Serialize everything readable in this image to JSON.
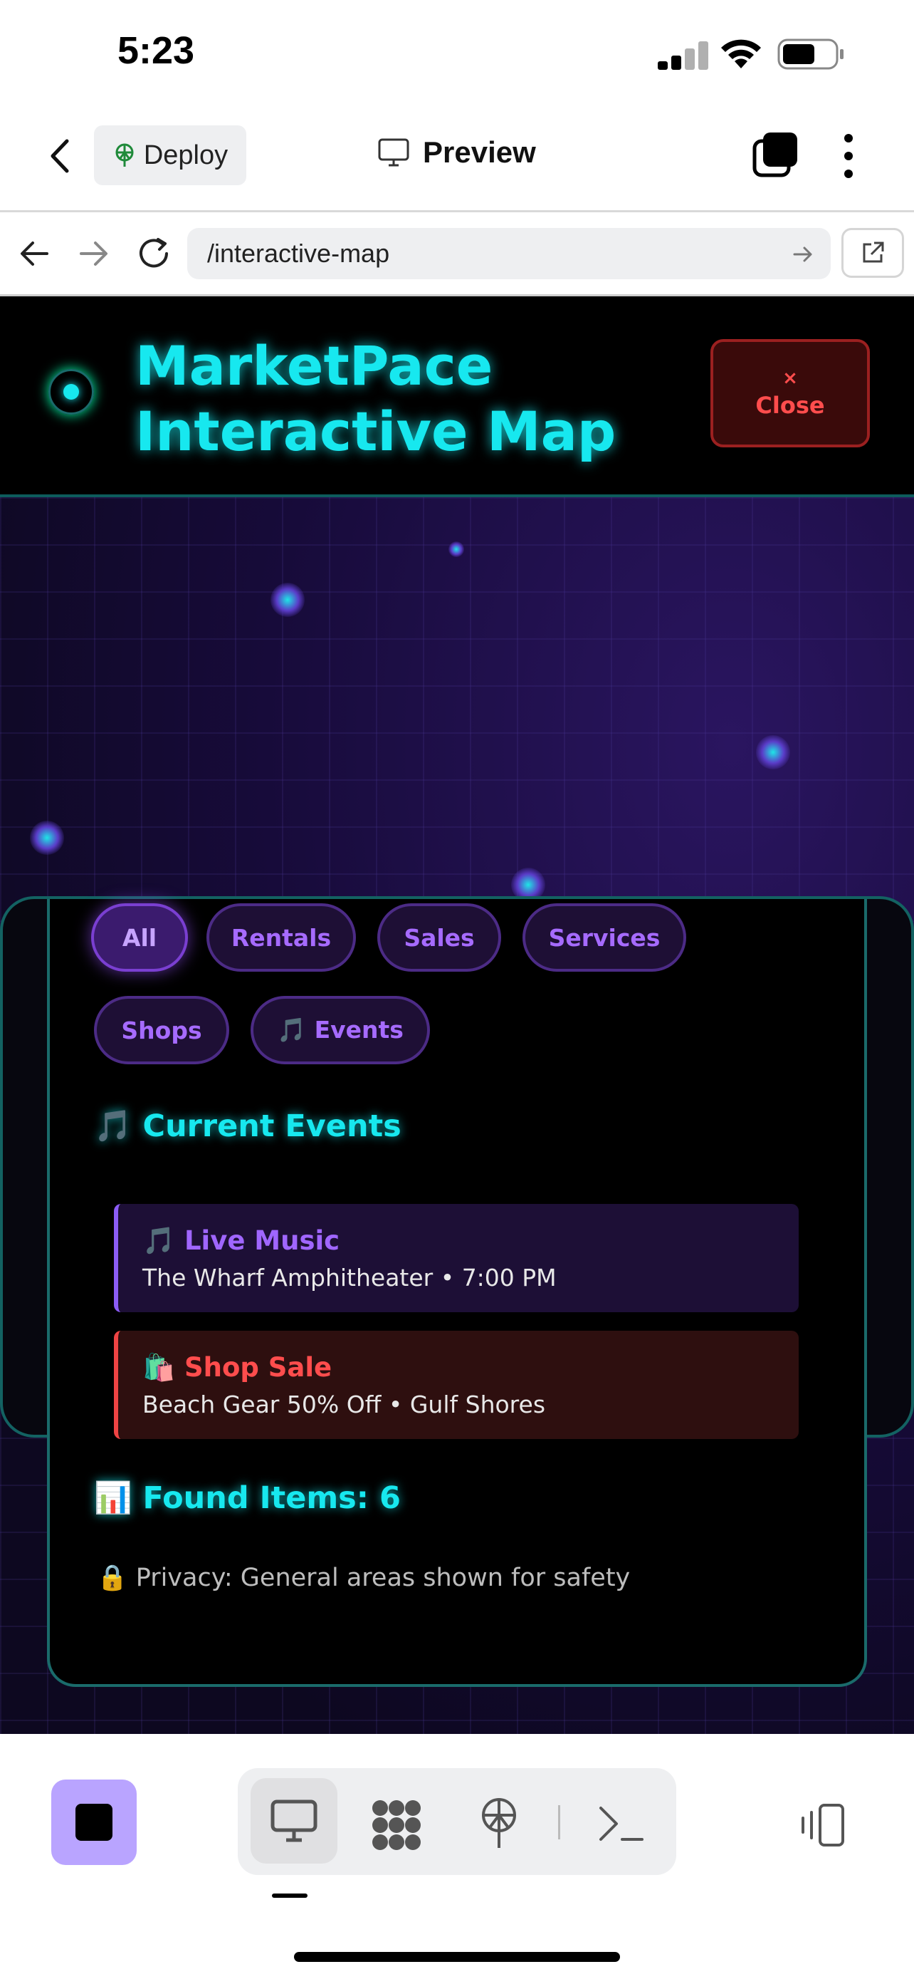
{
  "status": {
    "time": "5:23"
  },
  "header": {
    "deploy_label": "Deploy",
    "preview_label": "Preview"
  },
  "url": {
    "path": "/interactive-map"
  },
  "site": {
    "title_line1": "MarketPace",
    "title_line2": "Interactive Map",
    "close_x": "×",
    "close_label": "Close"
  },
  "filters": [
    {
      "label": "All",
      "active": true
    },
    {
      "label": "Rentals"
    },
    {
      "label": "Sales"
    },
    {
      "label": "Services"
    },
    {
      "label": "Shops"
    },
    {
      "label": "🎵 Events"
    }
  ],
  "events": {
    "title": "🎵 Current Events",
    "items": [
      {
        "title": "🎵 Live Music",
        "subtitle": "The Wharf Amphitheater • 7:00 PM",
        "accent": "#8b5cf6"
      },
      {
        "title": "🛍️ Shop Sale",
        "subtitle": "Beach Gear 50% Off • Gulf Shores",
        "accent": "#ef4444"
      }
    ]
  },
  "found_label": "📊 Found Items: 6",
  "privacy_label": "🔒 Privacy: General areas shown for safety",
  "colors": {
    "neon_cyan": "#17e8ef",
    "chip_purple": "#a66bff",
    "close_red": "#ff4d4d",
    "stop_button": "#b9a4ff"
  },
  "toolbar_icons": [
    "stop-icon",
    "desktop-icon",
    "components-icon",
    "deploy-icon",
    "terminal-icon",
    "device-toggle-icon"
  ]
}
